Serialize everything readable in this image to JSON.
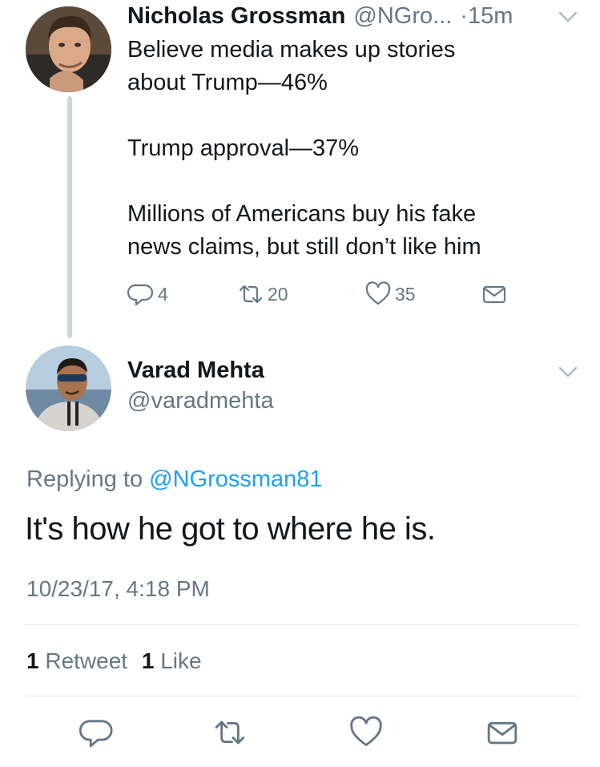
{
  "parent_tweet": {
    "author_name": "Nicholas Grossman",
    "author_handle": "@NGro...",
    "time": "·15m",
    "text_lines": [
      "Believe media makes up stories",
      "about Trump—46%",
      "",
      "Trump approval—37%",
      "",
      "Millions of Americans buy his fake",
      "news claims, but still don’t like him"
    ],
    "reply_count": "4",
    "retweet_count": "20",
    "like_count": "35"
  },
  "main_tweet": {
    "author_name": "Varad Mehta",
    "author_handle": "@varadmehta",
    "replying_prefix": "Replying to ",
    "replying_to": "@NGrossman81",
    "text": "It's how he got to where he is.",
    "timestamp": "10/23/17, 4:18 PM",
    "retweets_count": "1",
    "retweets_label": "Retweet",
    "likes_count": "1",
    "likes_label": "Like"
  },
  "colors": {
    "accent": "#1da1f2",
    "secondary_text": "#657786",
    "divider": "#e1e8ed"
  }
}
